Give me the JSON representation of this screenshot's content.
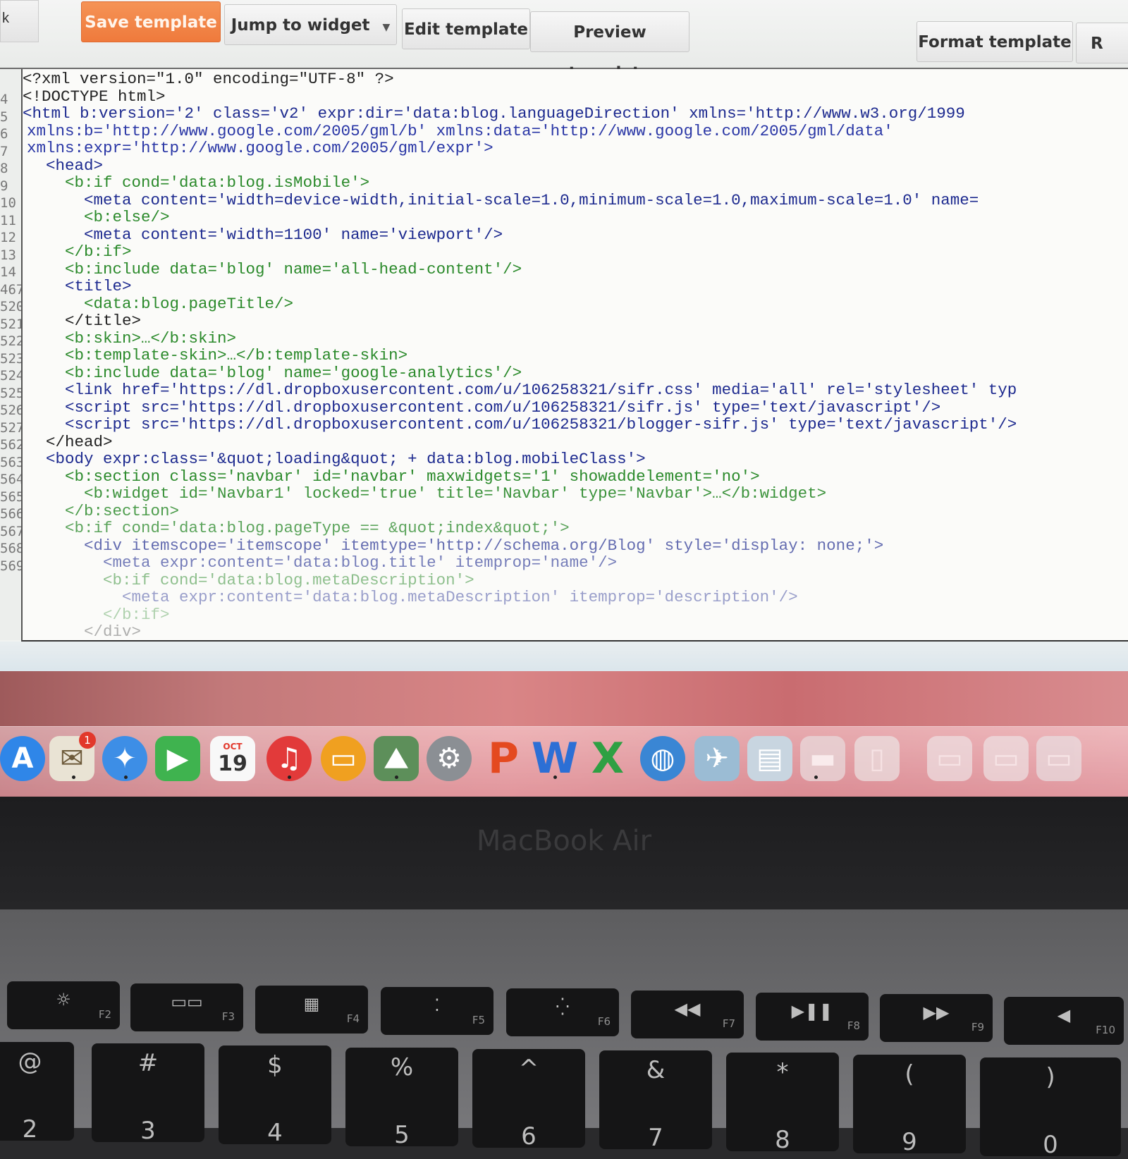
{
  "toolbar": {
    "left_stub": "k",
    "save": "Save template",
    "jump": "Jump to widget",
    "edit": "Edit template",
    "preview": "Preview template",
    "format": "Format template",
    "right_stub": "R"
  },
  "gutter": [
    "4",
    "5",
    "6",
    "7",
    "8",
    "9",
    "10",
    "11",
    "12",
    "13",
    "14",
    "467",
    "520",
    "521",
    "522",
    "523",
    "524",
    "525",
    "526",
    "527",
    "562",
    "563",
    "564",
    "565",
    "566",
    "567",
    "568",
    "569"
  ],
  "code_lines": [
    "<?xml version=\"1.0\" encoding=\"UTF-8\" ?>",
    "<!DOCTYPE html>",
    "<html b:version='2' class='v2' expr:dir='data:blog.languageDirection' xmlns='http://www.w3.org/1999",
    "xmlns:b='http://www.google.com/2005/gml/b' xmlns:data='http://www.google.com/2005/gml/data'",
    "xmlns:expr='http://www.google.com/2005/gml/expr'>",
    "  <head>",
    "    <b:if cond='data:blog.isMobile'>",
    "      <meta content='width=device-width,initial-scale=1.0,minimum-scale=1.0,maximum-scale=1.0' name=",
    "      <b:else/>",
    "      <meta content='width=1100' name='viewport'/>",
    "    </b:if>",
    "    <b:include data='blog' name='all-head-content'/>",
    "    <title>",
    "      <data:blog.pageTitle/>",
    "    </title>",
    "    <b:skin>…</b:skin>",
    "    <b:template-skin>…</b:template-skin>",
    "    <b:include data='blog' name='google-analytics'/>",
    "    <link href='https://dl.dropboxusercontent.com/u/106258321/sifr.css' media='all' rel='stylesheet' typ",
    "    <script src='https://dl.dropboxusercontent.com/u/106258321/sifr.js' type='text/javascript'/>",
    "    <script src='https://dl.dropboxusercontent.com/u/106258321/blogger-sifr.js' type='text/javascript'/>",
    "  </head>",
    "  <body expr:class='&quot;loading&quot; + data:blog.mobileClass'>",
    "    <b:section class='navbar' id='navbar' maxwidgets='1' showaddelement='no'>",
    "      <b:widget id='Navbar1' locked='true' title='Navbar' type='Navbar'>…</b:widget>",
    "    </b:section>",
    "    <b:if cond='data:blog.pageType == &quot;index&quot;'>",
    "      <div itemscope='itemscope' itemtype='http://schema.org/Blog' style='display: none;'>",
    "        <meta expr:content='data:blog.title' itemprop='name'/>",
    "        <b:if cond='data:blog.metaDescription'>",
    "          <meta expr:content='data:blog.metaDescription' itemprop='description'/>",
    "        </b:if>",
    "      </div>"
  ],
  "dock": {
    "calendar_month": "OCT",
    "calendar_day": "19",
    "mail_badge": "1"
  },
  "bezel_label": "MacBook Air",
  "keys": {
    "f2": "F2",
    "f3": "F3",
    "f4": "F4",
    "f5": "F5",
    "f6": "F6",
    "f7": "F7",
    "f8": "F8",
    "f9": "F9",
    "f10": "F10",
    "n2_top": "@",
    "n2_bot": "2",
    "n3_top": "#",
    "n3_bot": "3",
    "n4_top": "$",
    "n4_bot": "4",
    "n5_top": "%",
    "n5_bot": "5",
    "n6_top": "^",
    "n6_bot": "6",
    "n7_top": "&",
    "n7_bot": "7",
    "n8_top": "*",
    "n8_bot": "8",
    "n9_top": "(",
    "n9_bot": "9",
    "n0_top": ")",
    "n0_bot": "0"
  },
  "colors": {
    "save_button": "#ef7a3c",
    "attribute": "#2a37a6",
    "string": "#a8561c",
    "blogger_tag": "#2b8a2b"
  }
}
